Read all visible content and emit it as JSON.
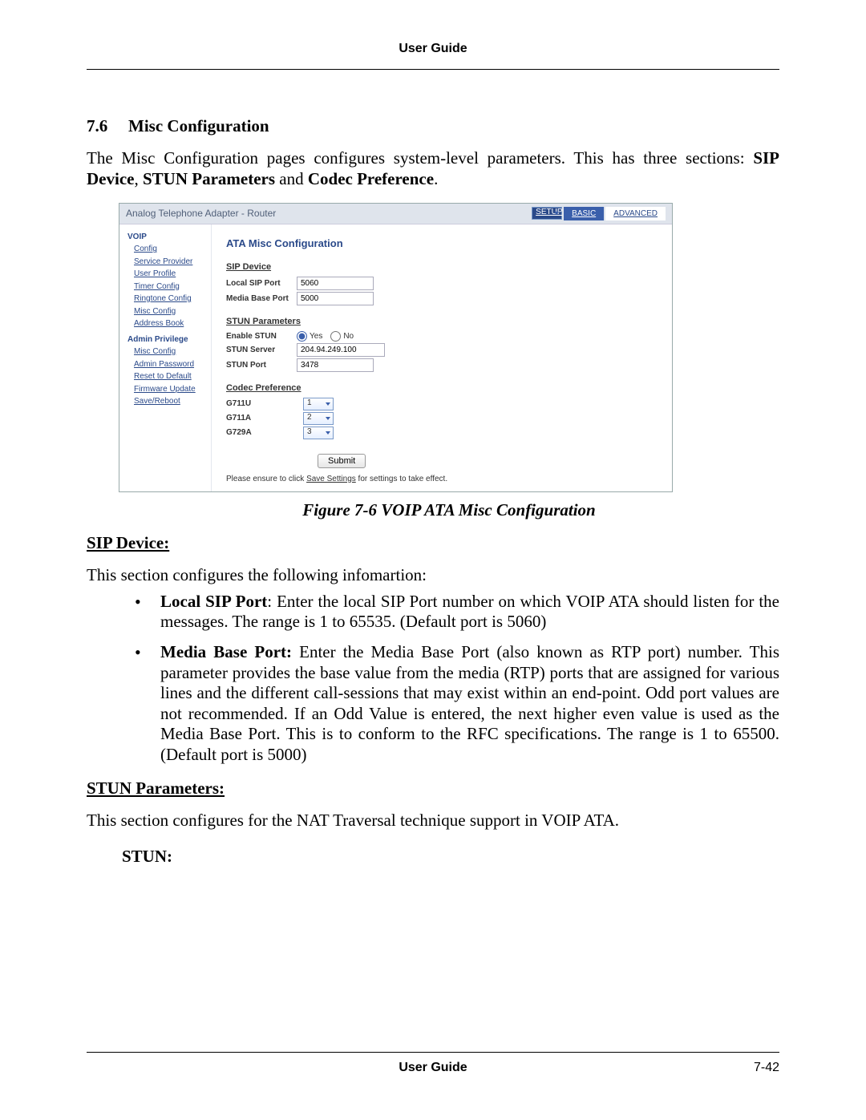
{
  "header": {
    "title": "User Guide"
  },
  "section": {
    "number": "7.6",
    "title": "Misc Configuration"
  },
  "intro": {
    "pre": "The Misc Configuration pages configures system-level parameters. This has three sections: ",
    "b1": "SIP Device",
    "sep1": ", ",
    "b2": "STUN Parameters",
    "mid": " and ",
    "b3": "Codec Preference",
    "end": "."
  },
  "figure": {
    "window_title": "Analog Telephone Adapter - Router",
    "tabs": {
      "setup": "SETUP",
      "basic": "BASIC",
      "advanced": "ADVANCED"
    },
    "nav": {
      "group1": "VOIP",
      "items1": [
        "Config",
        "Service Provider",
        "User Profile",
        "Timer Config",
        "Ringtone Config",
        "Misc Config",
        "Address Book"
      ],
      "group2": "Admin Privilege",
      "items2": [
        "Misc Config",
        "Admin Password",
        "Reset to Default",
        "Firmware Update",
        "Save/Reboot"
      ]
    },
    "panel": {
      "title": "ATA Misc Configuration",
      "sip": {
        "head": "SIP Device",
        "local_sip_port_label": "Local SIP Port",
        "local_sip_port": "5060",
        "media_base_port_label": "Media Base Port",
        "media_base_port": "5000"
      },
      "stun": {
        "head": "STUN Parameters",
        "enable_label": "Enable STUN",
        "yes": "Yes",
        "no": "No",
        "server_label": "STUN Server",
        "server": "204.94.249.100",
        "port_label": "STUN Port",
        "port": "3478"
      },
      "codec": {
        "head": "Codec Preference",
        "g711u_label": "G711U",
        "g711u": "1",
        "g711a_label": "G711A",
        "g711a": "2",
        "g729a_label": "G729A",
        "g729a": "3"
      },
      "submit": "Submit",
      "note_pre": "Please ensure to click ",
      "note_link": "Save Settings",
      "note_post": " for settings to take effect."
    },
    "caption": "Figure 7-6 VOIP ATA Misc Configuration"
  },
  "sip_device": {
    "head": "SIP Device:",
    "desc": "This section configures the following infomartion:",
    "b1_label": "Local SIP Port",
    "b1_text": ": Enter the local SIP Port number on which VOIP ATA should listen for the messages. The range is 1 to 65535. (Default port is 5060)",
    "b2_label": "Media Base Port:",
    "b2_text": " Enter the Media Base Port (also known as RTP port) number. This parameter provides the base value from the media (RTP) ports that are assigned for various lines and the different call-sessions that may exist within an end-point. Odd port values are not recommended. If an Odd Value is entered, the next higher even value is used as the Media Base Port. This is to conform to the RFC specifications. The range is 1 to 65500. (Default port is 5000)"
  },
  "stun_params": {
    "head": "STUN Parameters:",
    "desc": "This section configures for the NAT Traversal technique support in VOIP ATA.",
    "stun_head": "STUN:"
  },
  "footer": {
    "title": "User Guide",
    "page": "7-42"
  }
}
